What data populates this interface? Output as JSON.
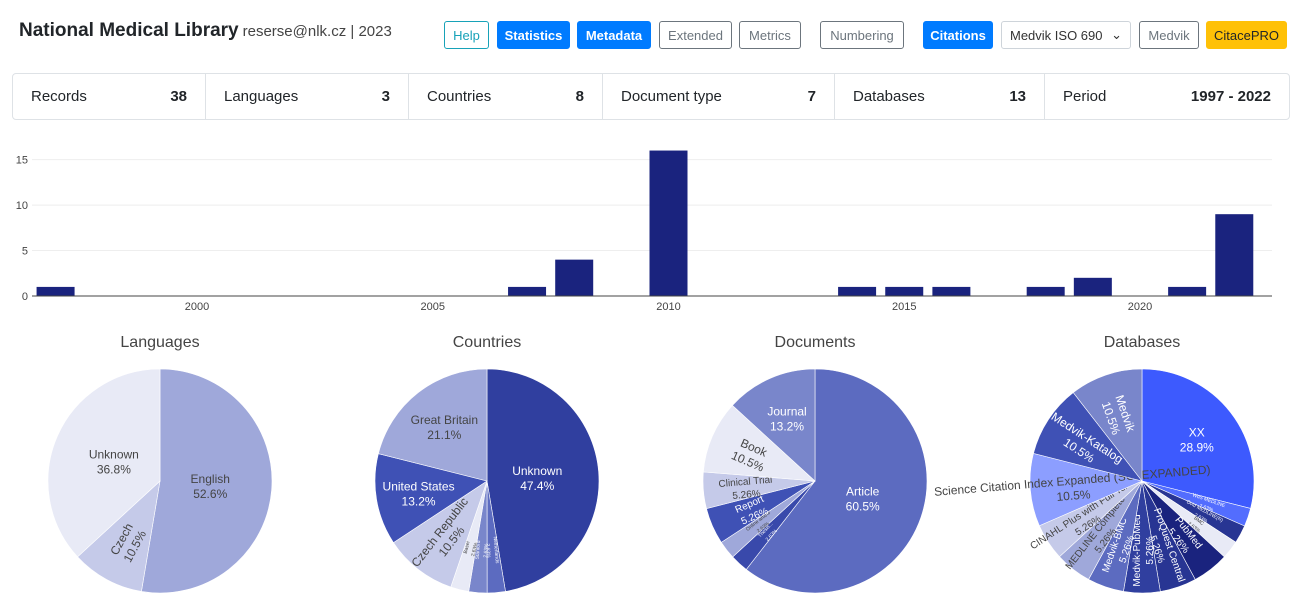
{
  "header": {
    "title": "National Medical Library",
    "subtitle": "reserse@nlk.cz | 2023"
  },
  "toolbar": {
    "help": "Help",
    "statistics": "Statistics",
    "metadata": "Metadata",
    "extended": "Extended",
    "metrics": "Metrics",
    "numbering": "Numbering",
    "citations": "Citations",
    "style_select": "Medvik ISO 690",
    "medvik": "Medvik",
    "citacepro": "CitacePRO"
  },
  "summary": [
    {
      "label": "Records",
      "value": "38"
    },
    {
      "label": "Languages",
      "value": "3"
    },
    {
      "label": "Countries",
      "value": "8"
    },
    {
      "label": "Document type",
      "value": "7"
    },
    {
      "label": "Databases",
      "value": "13"
    },
    {
      "label": "Period",
      "value": "1997 - 2022"
    }
  ],
  "chart_data": [
    {
      "type": "bar",
      "x": [
        1997,
        2007,
        2008,
        2010,
        2014,
        2015,
        2016,
        2018,
        2019,
        2021,
        2022
      ],
      "values": [
        1,
        1,
        4,
        16,
        1,
        1,
        1,
        1,
        2,
        1,
        9
      ],
      "xticks": [
        "2000",
        "2005",
        "2010",
        "2015",
        "2020"
      ],
      "yticks": [
        "0",
        "5",
        "10",
        "15"
      ],
      "ylim": [
        0,
        16.5
      ],
      "xlim": [
        1996.5,
        2022.8
      ],
      "color": "#1a237e",
      "grid": true
    },
    {
      "type": "pie",
      "title": "Languages",
      "labels": [
        "English",
        "Czech",
        "Unknown"
      ],
      "values": [
        52.6,
        10.5,
        36.8
      ],
      "text": [
        "52.6%",
        "10.5%",
        "36.8%"
      ],
      "colors": [
        "#9fa8da",
        "#c5cae9",
        "#e8eaf6"
      ]
    },
    {
      "type": "pie",
      "title": "Countries",
      "labels": [
        "Unknown",
        "Netherlands",
        "Stanford",
        "Basel",
        "Czech Republic",
        "United States",
        "Great Britain"
      ],
      "values": [
        47.4,
        2.63,
        2.63,
        2.63,
        10.5,
        13.2,
        21.1
      ],
      "text": [
        "47.4%",
        "2.63%",
        "2.63%",
        "2.63%",
        "10.5%",
        "13.2%",
        "21.1%"
      ],
      "colors": [
        "#303f9f",
        "#5c6bc0",
        "#7986cb",
        "#e8eaf6",
        "#c5cae9",
        "#3f51b5",
        "#9fa8da"
      ]
    },
    {
      "type": "pie",
      "title": "Documents",
      "labels": [
        "Article",
        "Thesis...",
        "Online article",
        "Report",
        "Clinical Trial",
        "Book",
        "Journal"
      ],
      "values": [
        60.5,
        2.63,
        2.63,
        5.26,
        5.26,
        10.5,
        13.2
      ],
      "text": [
        "60.5%",
        "2.63%",
        "2.63%",
        "5.26%",
        "5.26%",
        "10.5%",
        "13.2%"
      ],
      "colors": [
        "#5c6bc0",
        "#3949ab",
        "#9fa8da",
        "#3f51b5",
        "#c5cae9",
        "#e8eaf6",
        "#7986cb"
      ]
    },
    {
      "type": "pie",
      "title": "Databases",
      "labels": [
        "XX",
        "WoS MEDLINE",
        "Ovid MEDLINE(R)",
        "BMC",
        "PubMed",
        "ProQuest Central",
        "Medvik-PubMed",
        "Medvik-BMC",
        "MEDLINE Complete",
        "CINAHL Plus with Full Text",
        "Science Citation Index Expanded (SCI-EXPANDED)",
        "Medvik-Katalog",
        "Medvik"
      ],
      "values": [
        28.9,
        2.63,
        2.63,
        2.63,
        5.26,
        5.26,
        5.26,
        5.26,
        5.26,
        5.26,
        10.5,
        10.5,
        10.5
      ],
      "text": [
        "28.9%",
        "2.63%",
        "2.63%",
        "2.63%",
        "5.26%",
        "5.26%",
        "5.26%",
        "5.26%",
        "5.26%",
        "5.26%",
        "10.5%",
        "10.5%",
        "10.5%"
      ],
      "colors": [
        "#3d5afe",
        "#536dfe",
        "#283593",
        "#e8eaf6",
        "#1a237e",
        "#283593",
        "#303f9f",
        "#5c6bc0",
        "#9fa8da",
        "#c5cae9",
        "#8c9eff",
        "#3f51b5",
        "#7986cb"
      ]
    }
  ]
}
